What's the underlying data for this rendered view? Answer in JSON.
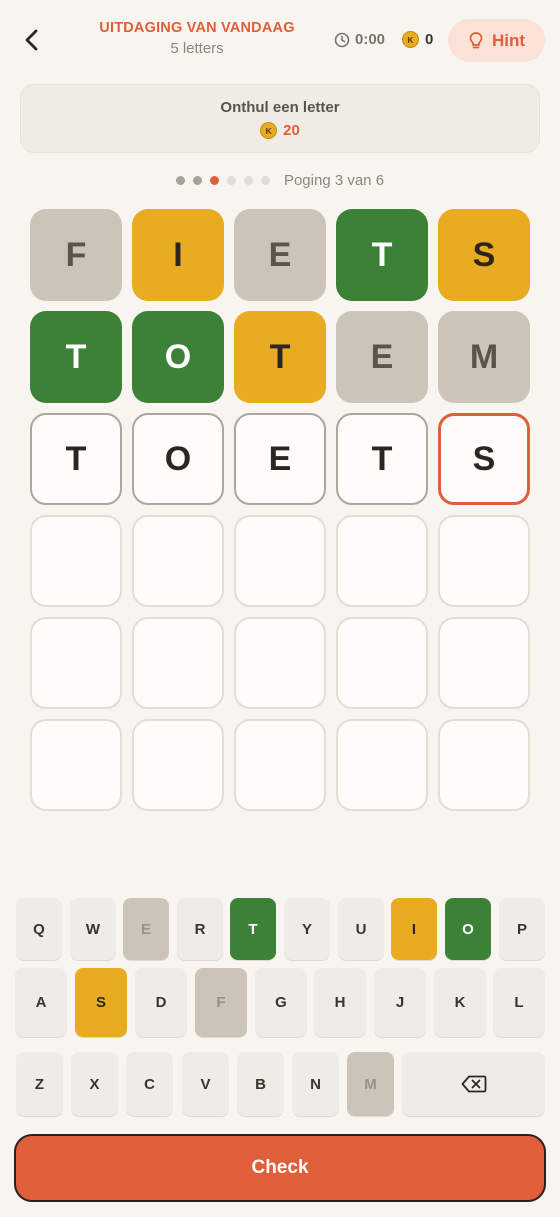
{
  "header": {
    "title": "UITDAGING VAN VANDAAG",
    "subtitle": "5 letters",
    "timer": "0:00",
    "coins": "0",
    "coin_symbol": "K",
    "hint_label": "Hint"
  },
  "reveal": {
    "title": "Onthul een letter",
    "cost": "20"
  },
  "progress": {
    "text": "Poging 3 van 6",
    "total_dots": 6,
    "current_index": 2
  },
  "board": {
    "rows": [
      [
        {
          "letter": "F",
          "state": "absent"
        },
        {
          "letter": "I",
          "state": "present"
        },
        {
          "letter": "E",
          "state": "absent"
        },
        {
          "letter": "T",
          "state": "correct"
        },
        {
          "letter": "S",
          "state": "present"
        }
      ],
      [
        {
          "letter": "T",
          "state": "correct"
        },
        {
          "letter": "O",
          "state": "correct"
        },
        {
          "letter": "T",
          "state": "present"
        },
        {
          "letter": "E",
          "state": "absent"
        },
        {
          "letter": "M",
          "state": "absent"
        }
      ],
      [
        {
          "letter": "T",
          "state": "filled"
        },
        {
          "letter": "O",
          "state": "filled"
        },
        {
          "letter": "E",
          "state": "filled"
        },
        {
          "letter": "T",
          "state": "filled"
        },
        {
          "letter": "S",
          "state": "active"
        }
      ],
      [
        {
          "letter": "",
          "state": "empty"
        },
        {
          "letter": "",
          "state": "empty"
        },
        {
          "letter": "",
          "state": "empty"
        },
        {
          "letter": "",
          "state": "empty"
        },
        {
          "letter": "",
          "state": "empty"
        }
      ],
      [
        {
          "letter": "",
          "state": "empty"
        },
        {
          "letter": "",
          "state": "empty"
        },
        {
          "letter": "",
          "state": "empty"
        },
        {
          "letter": "",
          "state": "empty"
        },
        {
          "letter": "",
          "state": "empty"
        }
      ],
      [
        {
          "letter": "",
          "state": "empty"
        },
        {
          "letter": "",
          "state": "empty"
        },
        {
          "letter": "",
          "state": "empty"
        },
        {
          "letter": "",
          "state": "empty"
        },
        {
          "letter": "",
          "state": "empty"
        }
      ]
    ]
  },
  "keyboard": {
    "rows": [
      [
        {
          "key": "Q",
          "state": "default"
        },
        {
          "key": "W",
          "state": "default"
        },
        {
          "key": "E",
          "state": "absent"
        },
        {
          "key": "R",
          "state": "default"
        },
        {
          "key": "T",
          "state": "correct"
        },
        {
          "key": "Y",
          "state": "default"
        },
        {
          "key": "U",
          "state": "default"
        },
        {
          "key": "I",
          "state": "present"
        },
        {
          "key": "O",
          "state": "correct"
        },
        {
          "key": "P",
          "state": "default"
        }
      ],
      [
        {
          "key": "A",
          "state": "default"
        },
        {
          "key": "S",
          "state": "present"
        },
        {
          "key": "D",
          "state": "default"
        },
        {
          "key": "F",
          "state": "absent"
        },
        {
          "key": "G",
          "state": "default"
        },
        {
          "key": "H",
          "state": "default"
        },
        {
          "key": "J",
          "state": "default"
        },
        {
          "key": "K",
          "state": "default"
        },
        {
          "key": "L",
          "state": "default"
        }
      ],
      [
        {
          "key": "Z",
          "state": "default"
        },
        {
          "key": "X",
          "state": "default"
        },
        {
          "key": "C",
          "state": "default"
        },
        {
          "key": "V",
          "state": "default"
        },
        {
          "key": "B",
          "state": "default"
        },
        {
          "key": "N",
          "state": "default"
        },
        {
          "key": "M",
          "state": "absent"
        },
        {
          "key": "",
          "state": "backspace",
          "icon": "backspace-icon"
        }
      ]
    ]
  },
  "check_label": "Check",
  "colors": {
    "accent": "#e05e3a",
    "correct": "#3b8236",
    "present": "#e8ab22",
    "absent": "#ccc4b8"
  }
}
